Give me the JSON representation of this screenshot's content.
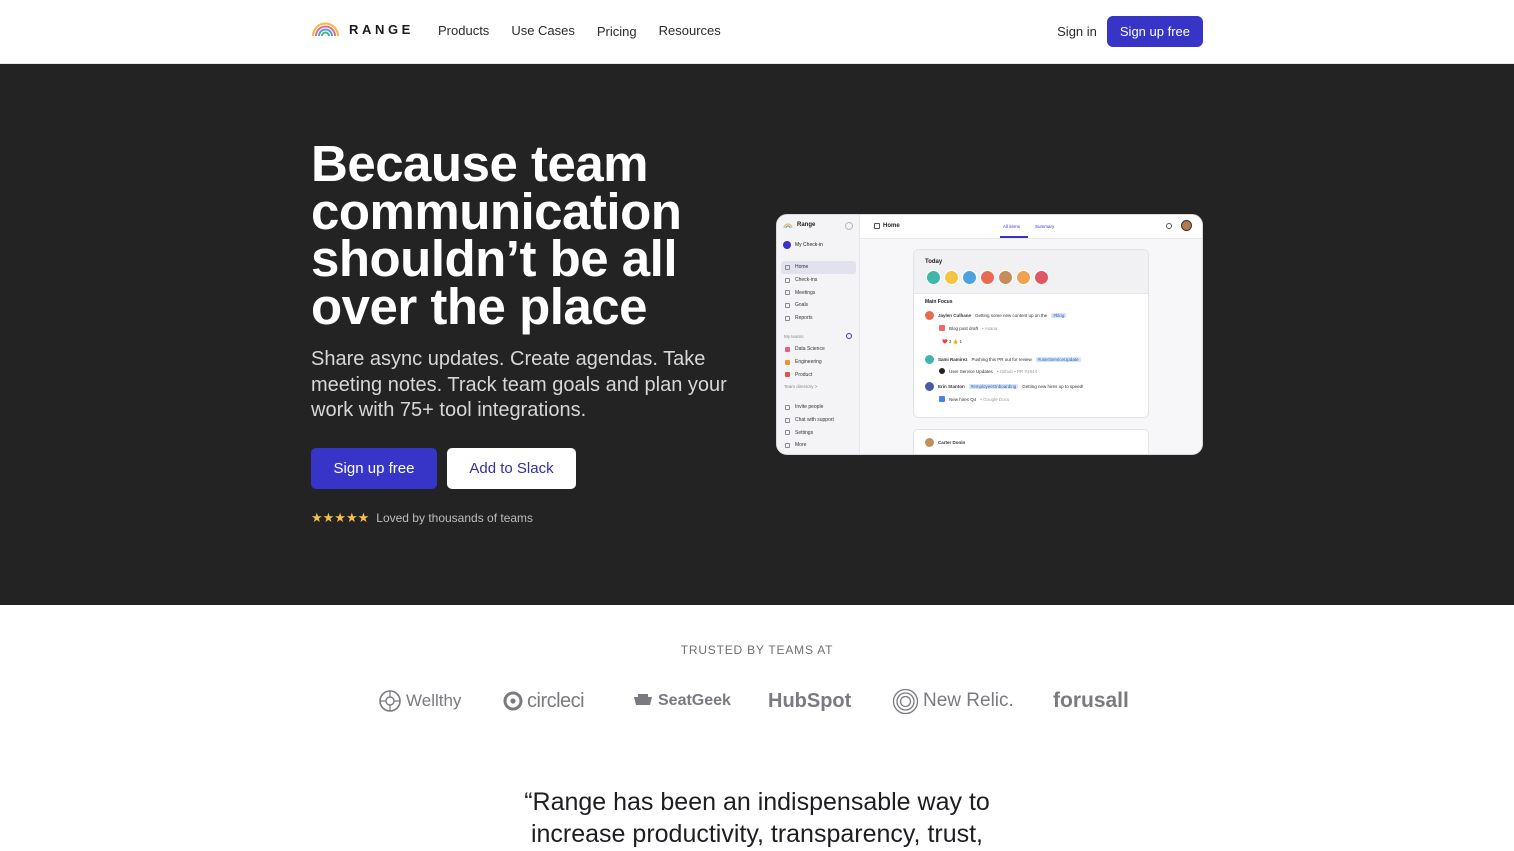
{
  "nav": {
    "brand": "RANGE",
    "links": [
      "Products",
      "Use Cases",
      "Pricing",
      "Resources"
    ],
    "signin": "Sign in",
    "signup": "Sign up free"
  },
  "hero": {
    "headline": "Because team communication shouldn’t be all over the place",
    "subtitle": "Share async updates. Create agendas. Take meeting notes. Track team goals and plan your work with 75+ tool integrations.",
    "primary_cta": "Sign up free",
    "secondary_cta": "Add to Slack",
    "stars": "★★★★★",
    "rating_text": "Loved by thousands of teams"
  },
  "app_preview": {
    "brand": "Range",
    "my_checkin": "My Check-in",
    "nav_items": [
      "Home",
      "Check-ins",
      "Meetings",
      "Goals",
      "Reports"
    ],
    "teams_heading": "My teams",
    "teams": [
      {
        "name": "Data Science",
        "color": "#e85d8a"
      },
      {
        "name": "Engineering",
        "color": "#f0932b"
      },
      {
        "name": "Product",
        "color": "#eb4d4b"
      }
    ],
    "team_directory": "Team directory  >",
    "bottom_items": [
      "Invite people",
      "Chat with support",
      "Settings",
      "More"
    ],
    "page_title": "Home",
    "tabs": [
      "All items",
      "Summary"
    ],
    "today": "Today",
    "avatar_colors": [
      "#3fb6a8",
      "#f5c542",
      "#4aa3df",
      "#e86a50",
      "#c58c5c",
      "#f0a24e",
      "#e25563"
    ],
    "main_focus": "Main Focus",
    "feed": [
      {
        "name": "Jaylen Culhane",
        "text": "Getting some new content up on the",
        "tag": "#blog"
      },
      {
        "item": "Blog post draft",
        "source": "• Asana"
      },
      {
        "reactions": "❤️ 3   👍 1"
      },
      {
        "name": "Sami Ramirez",
        "text": "Pushing this PR out for review",
        "tag": "#userServiceUpdate"
      },
      {
        "item": "User Service Updates",
        "source": "• Github • PR #1844"
      },
      {
        "name": "Erin Stanton",
        "tag": "#employeeOnboarding",
        "text": "Getting new hires up to speed!"
      },
      {
        "item": "New hires Q4",
        "source": "• Google Docs"
      }
    ],
    "next_card_name": "Carter Donin"
  },
  "trust": {
    "label": "TRUSTED BY TEAMS AT",
    "logos": [
      "Wellthy",
      "circleci",
      "SeatGeek",
      "HubSpot",
      "New Relic.",
      "forusall"
    ]
  },
  "quote": {
    "line1": "“Range has been an indispensable way to",
    "line2": "increase productivity, transparency, trust,"
  },
  "colors": {
    "accent": "#3734c8",
    "hero_bg": "#232323",
    "star": "#f3c14b"
  }
}
